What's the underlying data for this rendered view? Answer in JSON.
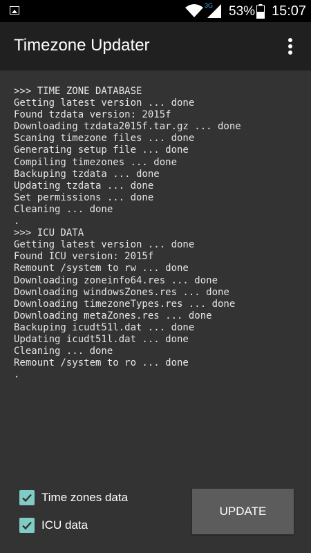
{
  "status_bar": {
    "network_type": "3G",
    "battery_percent": "53%",
    "time": "15:07"
  },
  "app_bar": {
    "title": "Timezone Updater",
    "overflow_icon": "more-vert-icon"
  },
  "log_lines": [
    ">>> TIME ZONE DATABASE",
    "Getting latest version ... done",
    "Found tzdata version: 2015f",
    "Downloading tzdata2015f.tar.gz ... done",
    "Scaning timezone files ... done",
    "Generating setup file ... done",
    "Compiling timezones ... done",
    "Backuping tzdata ... done",
    "Updating tzdata ... done",
    "Set permissions ... done",
    "Cleaning ... done",
    ".",
    ">>> ICU DATA",
    "Getting latest version ... done",
    "Found ICU version: 2015f",
    "Remount /system to rw ... done",
    "Downloading zoneinfo64.res ... done",
    "Downloading windowsZones.res ... done",
    "Downloading timezoneTypes.res ... done",
    "Downloading metaZones.res ... done",
    "Backuping icudt51l.dat ... done",
    "Updating icudt51l.dat ... done",
    "Cleaning ... done",
    "Remount /system to ro ... done",
    "."
  ],
  "options": {
    "time_zones": {
      "label": "Time zones data",
      "checked": true
    },
    "icu": {
      "label": "ICU data",
      "checked": true
    }
  },
  "update_button": {
    "label": "UPDATE"
  },
  "colors": {
    "background": "#333333",
    "app_bar": "#202020",
    "status_bar": "#000000",
    "checkbox": "#80cbc4",
    "button": "#5c5c5c",
    "network_accent": "#3fa9f5"
  }
}
